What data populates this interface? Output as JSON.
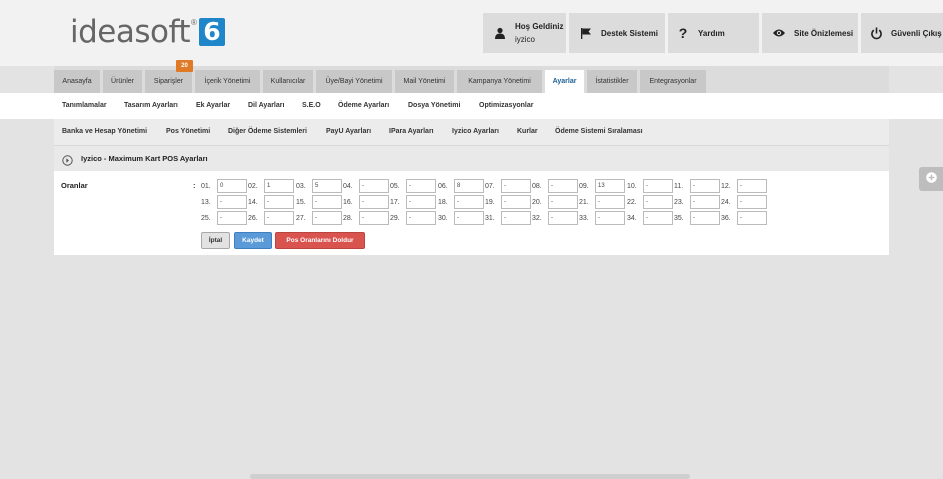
{
  "brand": {
    "logo_text": "ideasoft",
    "logo_reg": "®",
    "logo_badge": "6"
  },
  "header": {
    "welcome_title": "Hoş Geldiniz",
    "welcome_user": "iyzico",
    "support": "Destek Sistemi",
    "help": "Yardım",
    "preview": "Site Önizlemesi",
    "logout": "Güvenli Çıkış"
  },
  "main_tabs": [
    "Anasayfa",
    "Ürünler",
    "Siparişler",
    "İçerik Yönetimi",
    "Kullanıcılar",
    "Üye/Bayi Yönetimi",
    "Mail Yönetimi",
    "Kampanya Yönetimi",
    "Ayarlar",
    "İstatistikler",
    "Entegrasyonlar"
  ],
  "active_tab": "Ayarlar",
  "orders_badge": "20",
  "sub_nav": [
    "Tanımlamalar",
    "Tasarım Ayarları",
    "Ek Ayarlar",
    "Dil Ayarları",
    "S.E.O",
    "Ödeme Ayarları",
    "Dosya Yönetimi",
    "Optimizasyonlar"
  ],
  "sub_nav2": [
    "Banka ve Hesap Yönetimi",
    "Pos Yönetimi",
    "Diğer Ödeme Sistemleri",
    "PayU Ayarları",
    "IPara Ayarları",
    "Iyzico Ayarları",
    "Kurlar",
    "Ödeme Sistemi Sıralaması"
  ],
  "panel": {
    "title": "Iyzico - Maximum Kart POS Ayarları",
    "rates_label": "Oranlar",
    "colon": ":",
    "rates": [
      {
        "n": "01.",
        "v": "0"
      },
      {
        "n": "02.",
        "v": "1"
      },
      {
        "n": "03.",
        "v": "5"
      },
      {
        "n": "04.",
        "v": "-"
      },
      {
        "n": "05.",
        "v": "-"
      },
      {
        "n": "06.",
        "v": "8"
      },
      {
        "n": "07.",
        "v": "-"
      },
      {
        "n": "08.",
        "v": "-"
      },
      {
        "n": "09.",
        "v": "13"
      },
      {
        "n": "10.",
        "v": "-"
      },
      {
        "n": "11.",
        "v": "-"
      },
      {
        "n": "12.",
        "v": "-"
      },
      {
        "n": "13.",
        "v": "-"
      },
      {
        "n": "14.",
        "v": "-"
      },
      {
        "n": "15.",
        "v": "-"
      },
      {
        "n": "16.",
        "v": "-"
      },
      {
        "n": "17.",
        "v": "-"
      },
      {
        "n": "18.",
        "v": "-"
      },
      {
        "n": "19.",
        "v": "-"
      },
      {
        "n": "20.",
        "v": "-"
      },
      {
        "n": "21.",
        "v": "-"
      },
      {
        "n": "22.",
        "v": "-"
      },
      {
        "n": "23.",
        "v": "-"
      },
      {
        "n": "24.",
        "v": "-"
      },
      {
        "n": "25.",
        "v": "-"
      },
      {
        "n": "26.",
        "v": "-"
      },
      {
        "n": "27.",
        "v": "-"
      },
      {
        "n": "28.",
        "v": "-"
      },
      {
        "n": "29.",
        "v": "-"
      },
      {
        "n": "30.",
        "v": "-"
      },
      {
        "n": "31.",
        "v": "-"
      },
      {
        "n": "32.",
        "v": "-"
      },
      {
        "n": "33.",
        "v": "-"
      },
      {
        "n": "34.",
        "v": "-"
      },
      {
        "n": "35.",
        "v": "-"
      },
      {
        "n": "36.",
        "v": "-"
      }
    ],
    "buttons": {
      "cancel": "İptal",
      "save": "Kaydet",
      "fill": "Pos Oranlarını Doldur"
    }
  },
  "colors": {
    "save_button": "#5b9ad8",
    "fill_button": "#d9534f",
    "orders_badge": "#e07a26",
    "logo_badge": "#1f86c9"
  }
}
